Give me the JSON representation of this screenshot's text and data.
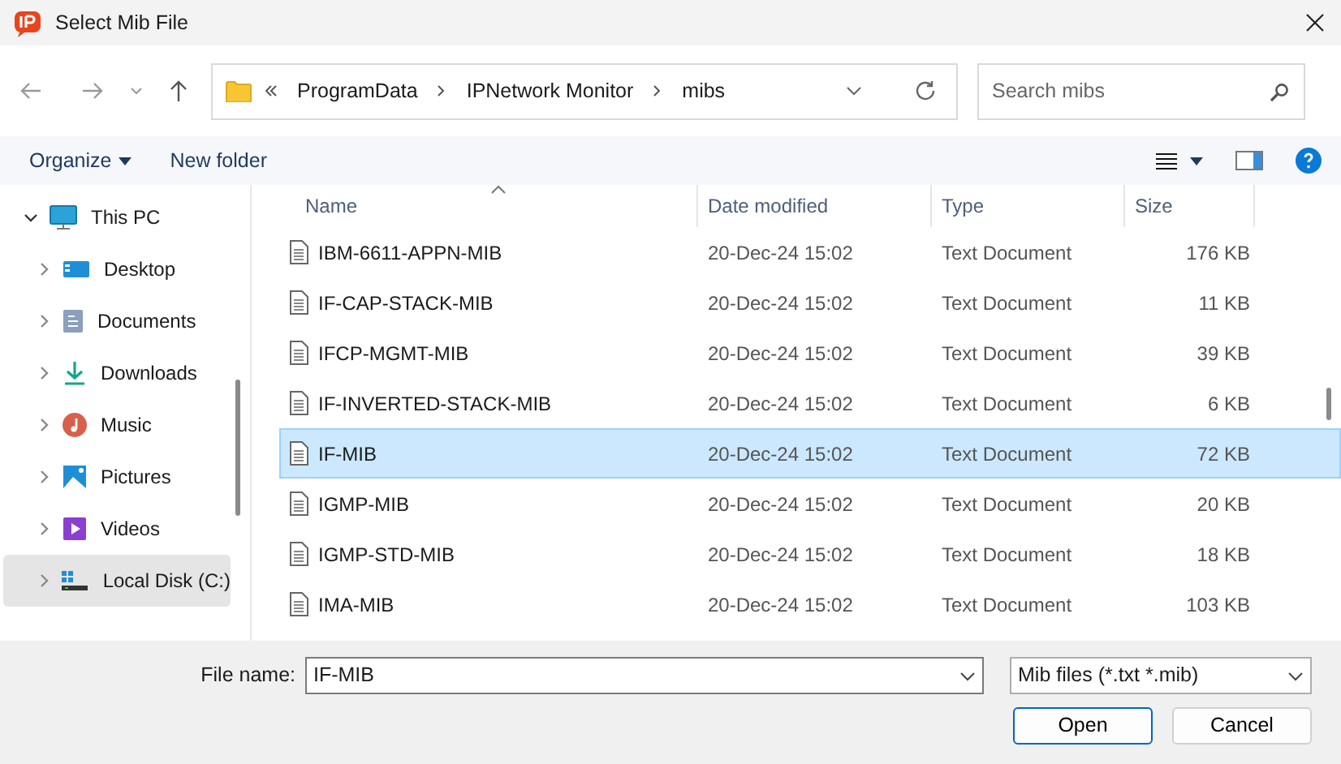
{
  "window": {
    "title": "Select Mib File"
  },
  "address_bar": {
    "path": [
      "ProgramData",
      "IPNetwork Monitor",
      "mibs"
    ]
  },
  "search": {
    "placeholder": "Search mibs"
  },
  "toolbar": {
    "organize": "Organize",
    "new_folder": "New folder"
  },
  "sidebar": {
    "items": [
      {
        "label": "This PC",
        "kind": "pc",
        "expanded": true,
        "selected": false,
        "children": [
          {
            "label": "Desktop",
            "kind": "desktop",
            "expanded": false,
            "selected": false
          },
          {
            "label": "Documents",
            "kind": "documents",
            "expanded": false,
            "selected": false
          },
          {
            "label": "Downloads",
            "kind": "downloads",
            "expanded": false,
            "selected": false
          },
          {
            "label": "Music",
            "kind": "music",
            "expanded": false,
            "selected": false
          },
          {
            "label": "Pictures",
            "kind": "pictures",
            "expanded": false,
            "selected": false
          },
          {
            "label": "Videos",
            "kind": "videos",
            "expanded": false,
            "selected": false
          },
          {
            "label": "Local Disk (C:)",
            "kind": "disk",
            "expanded": false,
            "selected": true
          }
        ]
      }
    ]
  },
  "table": {
    "columns": [
      "Name",
      "Date modified",
      "Type",
      "Size"
    ],
    "rows": [
      {
        "name": "IBM-6611-APPN-MIB",
        "date": "20-Dec-24 15:02",
        "type": "Text Document",
        "size": "176 KB",
        "selected": false
      },
      {
        "name": "IF-CAP-STACK-MIB",
        "date": "20-Dec-24 15:02",
        "type": "Text Document",
        "size": "11 KB",
        "selected": false
      },
      {
        "name": "IFCP-MGMT-MIB",
        "date": "20-Dec-24 15:02",
        "type": "Text Document",
        "size": "39 KB",
        "selected": false
      },
      {
        "name": "IF-INVERTED-STACK-MIB",
        "date": "20-Dec-24 15:02",
        "type": "Text Document",
        "size": "6 KB",
        "selected": false
      },
      {
        "name": "IF-MIB",
        "date": "20-Dec-24 15:02",
        "type": "Text Document",
        "size": "72 KB",
        "selected": true
      },
      {
        "name": "IGMP-MIB",
        "date": "20-Dec-24 15:02",
        "type": "Text Document",
        "size": "20 KB",
        "selected": false
      },
      {
        "name": "IGMP-STD-MIB",
        "date": "20-Dec-24 15:02",
        "type": "Text Document",
        "size": "18 KB",
        "selected": false
      },
      {
        "name": "IMA-MIB",
        "date": "20-Dec-24 15:02",
        "type": "Text Document",
        "size": "103 KB",
        "selected": false
      }
    ]
  },
  "footer": {
    "file_name_label": "File name:",
    "file_name": "IF-MIB",
    "file_type": "Mib files (*.txt *.mib)",
    "open": "Open",
    "cancel": "Cancel"
  }
}
